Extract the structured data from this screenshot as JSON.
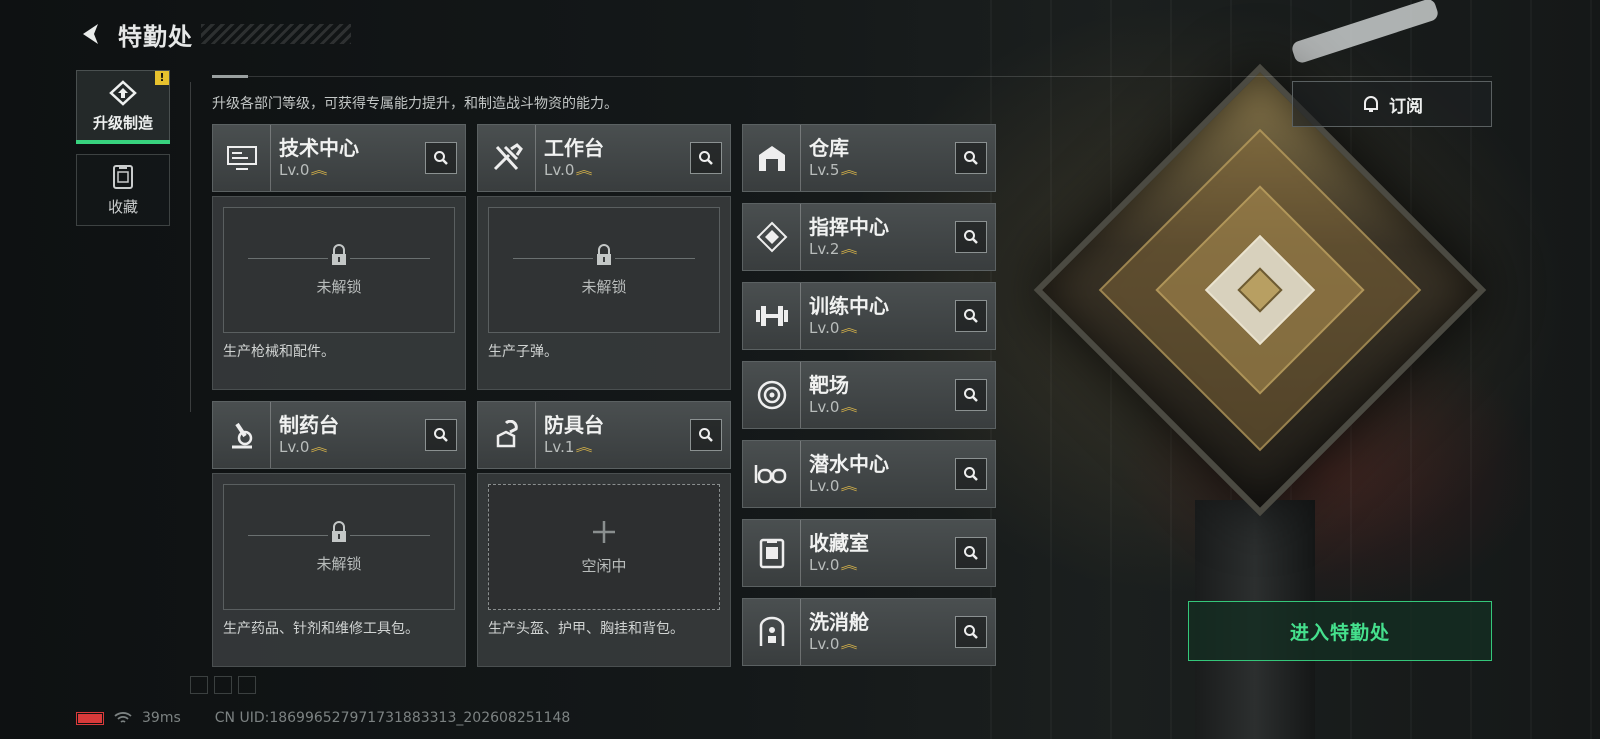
{
  "header": {
    "title": "特勤处"
  },
  "left_tabs": [
    {
      "label": "升级制造",
      "active": true,
      "alert": "!"
    },
    {
      "label": "收藏",
      "active": false
    }
  ],
  "intro": "升级各部门等级，可获得专属能力提升，和制造战斗物资的能力。",
  "production": [
    {
      "name": "技术中心",
      "level": "Lv.0",
      "slot_status": "未解锁",
      "description": "生产枪械和配件。",
      "icon": "computer-icon"
    },
    {
      "name": "工作台",
      "level": "Lv.0",
      "slot_status": "未解锁",
      "description": "生产子弹。",
      "icon": "tools-icon"
    },
    {
      "name": "制药台",
      "level": "Lv.0",
      "slot_status": "未解锁",
      "description": "生产药品、针剂和维修工具包。",
      "icon": "microscope-icon"
    },
    {
      "name": "防具台",
      "level": "Lv.1",
      "slot_status": "空闲中",
      "description": "生产头盔、护甲、胸挂和背包。",
      "icon": "armor-icon"
    }
  ],
  "facilities": [
    {
      "name": "仓库",
      "level": "Lv.5",
      "icon": "warehouse-icon"
    },
    {
      "name": "指挥中心",
      "level": "Lv.2",
      "icon": "command-icon"
    },
    {
      "name": "训练中心",
      "level": "Lv.0",
      "icon": "dumbbell-icon"
    },
    {
      "name": "靶场",
      "level": "Lv.0",
      "icon": "target-icon"
    },
    {
      "name": "潜水中心",
      "level": "Lv.0",
      "icon": "diving-mask-icon"
    },
    {
      "name": "收藏室",
      "level": "Lv.0",
      "icon": "collection-icon"
    },
    {
      "name": "洗消舱",
      "level": "Lv.0",
      "icon": "decontamination-icon"
    }
  ],
  "subscribe_label": "订阅",
  "enter_label": "进入特勤处",
  "footer": {
    "ping": "39ms",
    "uid": "CN UID:18699652797173188331​3_202608251148"
  },
  "colors": {
    "accent_green": "#38d27e",
    "level_chevron": "#d9b54a",
    "alert_yellow": "#e7c12e",
    "battery_red": "#d83a3a"
  }
}
